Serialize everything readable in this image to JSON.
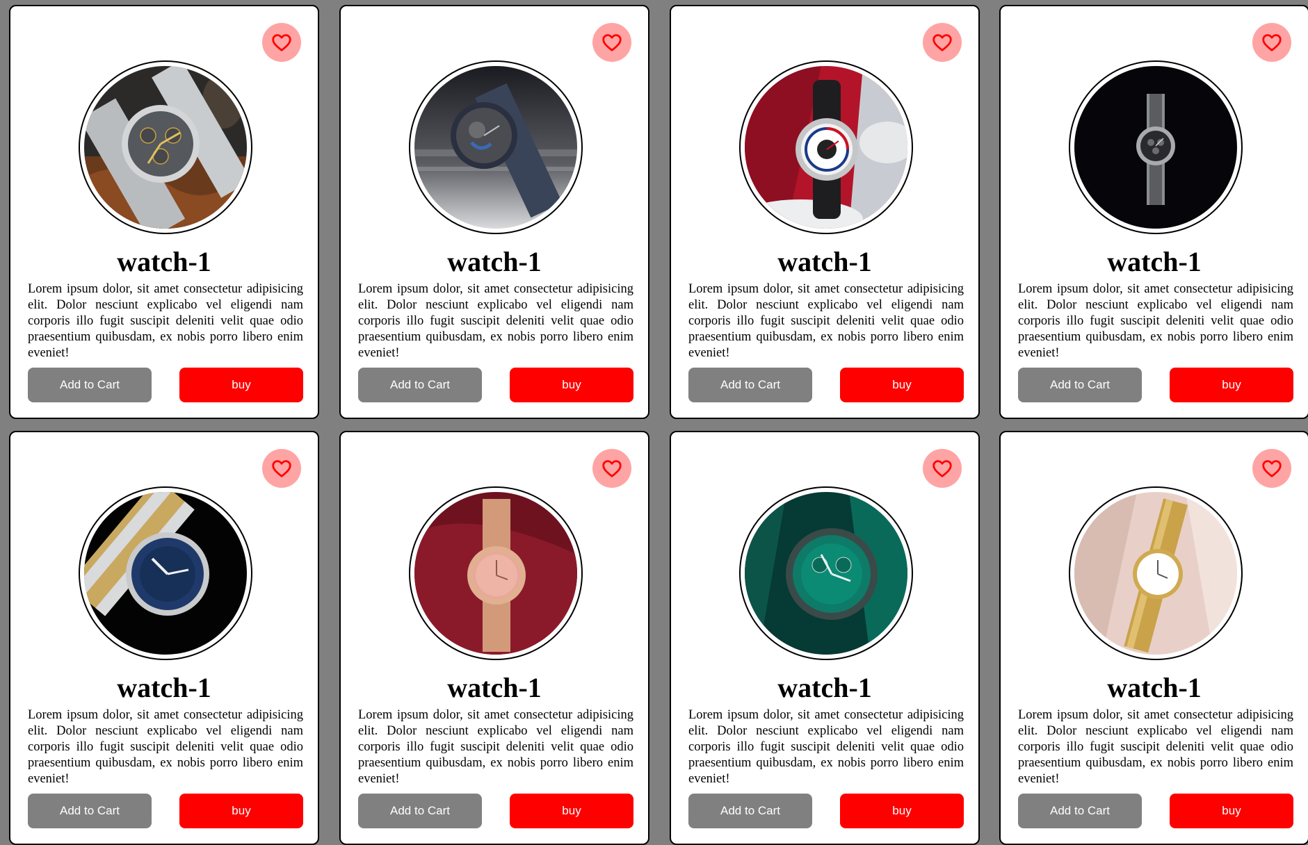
{
  "colors": {
    "page_background": "#808080",
    "card_background": "#ffffff",
    "favorite_background": "#ffa4a4",
    "heart": "#ff0000",
    "cart_button": "#808080",
    "buy_button": "#ff0000"
  },
  "products": [
    {
      "title": "watch-1",
      "description": "Lorem ipsum dolor, sit amet consectetur adipisicing elit. Dolor nesciunt explicabo vel eligendi nam corporis illo fugit suscipit deleniti velit quae odio praesentium quibusdam, ex nobis porro libero enim eveniet!",
      "add_to_cart_label": "Add to Cart",
      "buy_label": "buy",
      "favorite_icon": "heart-icon",
      "image": "silver-chronograph-watch"
    },
    {
      "title": "watch-1",
      "description": "Lorem ipsum dolor, sit amet consectetur adipisicing elit. Dolor nesciunt explicabo vel eligendi nam corporis illo fugit suscipit deleniti velit quae odio praesentium quibusdam, ex nobis porro libero enim eveniet!",
      "add_to_cart_label": "Add to Cart",
      "buy_label": "buy",
      "favorite_icon": "heart-icon",
      "image": "blue-skeleton-watch"
    },
    {
      "title": "watch-1",
      "description": "Lorem ipsum dolor, sit amet consectetur adipisicing elit. Dolor nesciunt explicabo vel eligendi nam corporis illo fugit suscipit deleniti velit quae odio praesentium quibusdam, ex nobis porro libero enim eveniet!",
      "add_to_cart_label": "Add to Cart",
      "buy_label": "buy",
      "favorite_icon": "heart-icon",
      "image": "pilot-watch-red-background"
    },
    {
      "title": "watch-1",
      "description": "Lorem ipsum dolor, sit amet consectetur adipisicing elit. Dolor nesciunt explicabo vel eligendi nam corporis illo fugit suscipit deleniti velit quae odio praesentium quibusdam, ex nobis porro libero enim eveniet!",
      "add_to_cart_label": "Add to Cart",
      "buy_label": "buy",
      "favorite_icon": "heart-icon",
      "image": "black-chronograph-watch"
    },
    {
      "title": "watch-1",
      "description": "Lorem ipsum dolor, sit amet consectetur adipisicing elit. Dolor nesciunt explicabo vel eligendi nam corporis illo fugit suscipit deleniti velit quae odio praesentium quibusdam, ex nobis porro libero enim eveniet!",
      "add_to_cart_label": "Add to Cart",
      "buy_label": "buy",
      "favorite_icon": "heart-icon",
      "image": "two-tone-diver-watch"
    },
    {
      "title": "watch-1",
      "description": "Lorem ipsum dolor, sit amet consectetur adipisicing elit. Dolor nesciunt explicabo vel eligendi nam corporis illo fugit suscipit deleniti velit quae odio praesentium quibusdam, ex nobis porro libero enim eveniet!",
      "add_to_cart_label": "Add to Cart",
      "buy_label": "buy",
      "favorite_icon": "heart-icon",
      "image": "rose-gold-mesh-watch"
    },
    {
      "title": "watch-1",
      "description": "Lorem ipsum dolor, sit amet consectetur adipisicing elit. Dolor nesciunt explicabo vel eligendi nam corporis illo fugit suscipit deleniti velit quae odio praesentium quibusdam, ex nobis porro libero enim eveniet!",
      "add_to_cart_label": "Add to Cart",
      "buy_label": "buy",
      "favorite_icon": "heart-icon",
      "image": "green-dial-chronograph"
    },
    {
      "title": "watch-1",
      "description": "Lorem ipsum dolor, sit amet consectetur adipisicing elit. Dolor nesciunt explicabo vel eligendi nam corporis illo fugit suscipit deleniti velit quae odio praesentium quibusdam, ex nobis porro libero enim eveniet!",
      "add_to_cart_label": "Add to Cart",
      "buy_label": "buy",
      "favorite_icon": "heart-icon",
      "image": "gold-bracelet-watch"
    }
  ]
}
